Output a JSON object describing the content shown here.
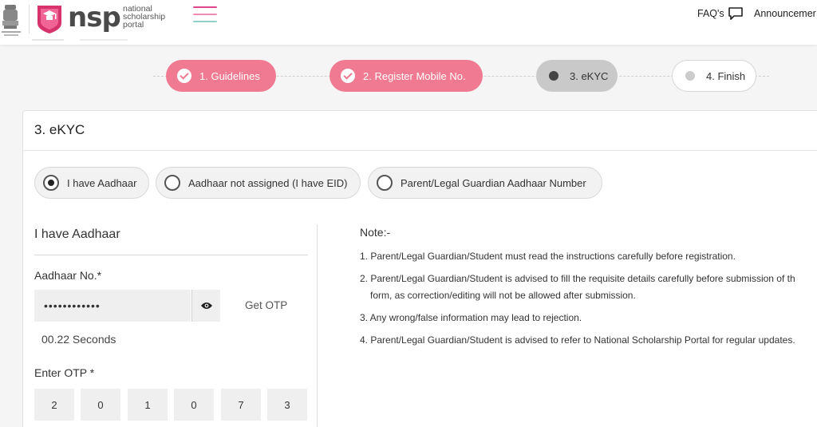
{
  "header": {
    "logo_text": "nsp",
    "logo_sub_1": "national",
    "logo_sub_2": "scholarship",
    "logo_sub_3": "portal",
    "faq_label": "FAQ's",
    "announcement_label": "Announcemer",
    "hamburger_colors": [
      "#e0468c",
      "#f08cb4",
      "#8fd3c8"
    ]
  },
  "stepper": {
    "steps": [
      {
        "label": "1. Guidelines",
        "state": "done"
      },
      {
        "label": "2. Register Mobile No.",
        "state": "done"
      },
      {
        "label": "3. eKYC",
        "state": "active"
      },
      {
        "label": "4. Finish",
        "state": "pending"
      }
    ],
    "accent": "#f07a91"
  },
  "card": {
    "title": "3. eKYC",
    "options": [
      {
        "label": "I have Aadhaar",
        "selected": true
      },
      {
        "label": "Aadhaar not assigned (I have EID)",
        "selected": false
      },
      {
        "label": "Parent/Legal Guardian Aadhaar Number",
        "selected": false
      }
    ],
    "section_title": "I have Aadhaar",
    "aadhaar_label": "Aadhaar No.*",
    "aadhaar_value": "••••••••••••",
    "get_otp_label": "Get OTP",
    "timer_text": "00.22 Seconds",
    "otp_label": "Enter OTP *",
    "otp_digits": [
      "2",
      "0",
      "1",
      "0",
      "7",
      "3"
    ]
  },
  "note": {
    "title": "Note:-",
    "items": [
      "1. Parent/Legal Guardian/Student must read the instructions carefully before registration.",
      "2. Parent/Legal Guardian/Student is advised to fill the requisite details carefully before submission of th",
      "form, as correction/editing will not be allowed after submission.",
      "3. Any wrong/false information may lead to rejection.",
      "4. Parent/Legal Guardian/Student is advised to refer to National Scholarship Portal for regular updates."
    ]
  }
}
